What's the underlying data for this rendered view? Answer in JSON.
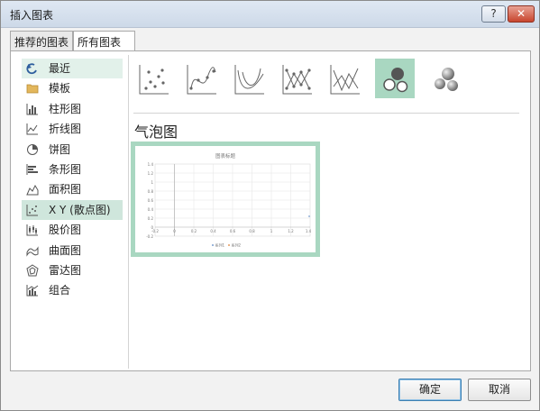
{
  "window": {
    "title": "插入图表",
    "help": "?",
    "close": "✕"
  },
  "tabs": [
    {
      "label": "推荐的图表"
    },
    {
      "label": "所有图表"
    }
  ],
  "sidebar": {
    "items": [
      {
        "label": "最近",
        "icon": "recent-icon",
        "selected": false
      },
      {
        "label": "模板",
        "icon": "folder-icon"
      },
      {
        "label": "柱形图",
        "icon": "column-chart-icon"
      },
      {
        "label": "折线图",
        "icon": "line-chart-icon"
      },
      {
        "label": "饼图",
        "icon": "pie-chart-icon"
      },
      {
        "label": "条形图",
        "icon": "bar-chart-icon"
      },
      {
        "label": "面积图",
        "icon": "area-chart-icon"
      },
      {
        "label": "X Y (散点图)",
        "icon": "scatter-chart-icon",
        "selected": true
      },
      {
        "label": "股价图",
        "icon": "stock-chart-icon"
      },
      {
        "label": "曲面图",
        "icon": "surface-chart-icon"
      },
      {
        "label": "雷达图",
        "icon": "radar-chart-icon"
      },
      {
        "label": "组合",
        "icon": "combo-chart-icon"
      }
    ]
  },
  "subtypes": [
    {
      "icon": "scatter-icon"
    },
    {
      "icon": "scatter-smooth-lines-markers-icon"
    },
    {
      "icon": "scatter-smooth-lines-icon"
    },
    {
      "icon": "scatter-straight-lines-markers-icon"
    },
    {
      "icon": "scatter-straight-lines-icon"
    },
    {
      "icon": "bubble-icon",
      "selected": true
    },
    {
      "icon": "3d-bubble-icon"
    }
  ],
  "section_title": "气泡图",
  "preview": {
    "title": "图表标题",
    "y_ticks": [
      "1.4",
      "1.2",
      "1",
      "0.8",
      "0.6",
      "0.4",
      "0.2",
      "0",
      "-0.2"
    ],
    "x_ticks": [
      "-0.2",
      "0",
      "0.2",
      "0.4",
      "0.6",
      "0.8",
      "1",
      "1.2",
      "1.4"
    ],
    "legend": [
      "系列1",
      "系列2"
    ]
  },
  "buttons": {
    "ok": "确定",
    "cancel": "取消"
  },
  "colors": {
    "accent": "#a9d7c1",
    "selected_item": "#cfe6dc",
    "dialog_bg": "#f2f2f2"
  }
}
